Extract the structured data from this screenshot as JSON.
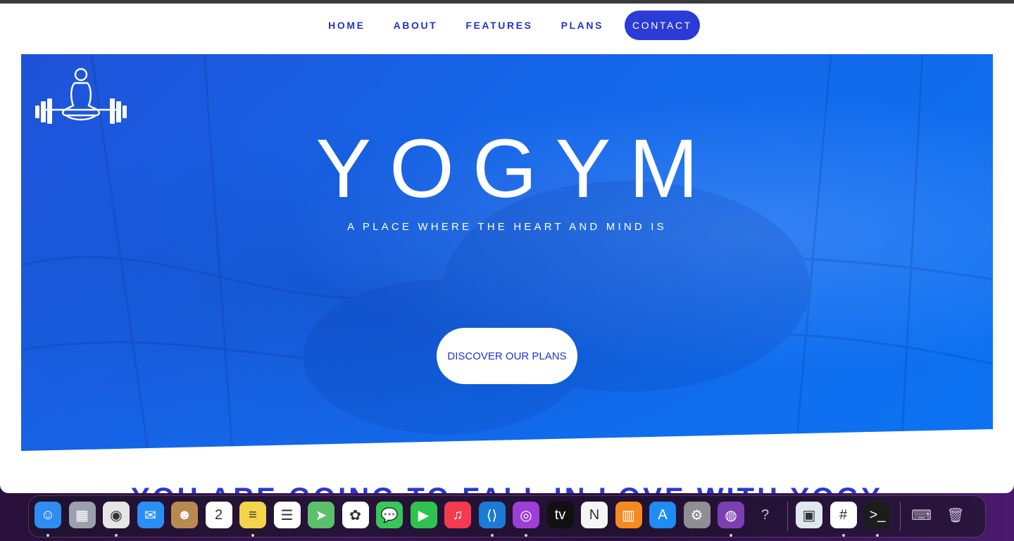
{
  "nav": {
    "items": [
      {
        "label": "HOME"
      },
      {
        "label": "ABOUT"
      },
      {
        "label": "FEATURES"
      },
      {
        "label": "PLANS"
      },
      {
        "label": "CONTACT"
      }
    ]
  },
  "hero": {
    "title": "YOGYM",
    "subtitle": "A PLACE WHERE THE HEART AND MIND IS",
    "cta_label": "DISCOVER OUR PLANS"
  },
  "section": {
    "heading": "YOU ARE GOING TO FALL IN LOVE WITH YOGYM"
  },
  "dock": {
    "apps": [
      {
        "name": "finder-icon",
        "color": "#2f8cf0",
        "glyph": "☺",
        "running": true
      },
      {
        "name": "launchpad-icon",
        "color": "#9aa0ad",
        "glyph": "▦",
        "running": false
      },
      {
        "name": "chrome-icon",
        "color": "#e5e5e5",
        "glyph": "◉",
        "running": true
      },
      {
        "name": "mail-icon",
        "color": "#2b8ef3",
        "glyph": "✉",
        "running": false
      },
      {
        "name": "contacts-icon",
        "color": "#b88a4f",
        "glyph": "☻",
        "running": false
      },
      {
        "name": "calendar-icon",
        "color": "#ffffff",
        "glyph": "2",
        "running": false
      },
      {
        "name": "notes-icon",
        "color": "#f4d44a",
        "glyph": "≡",
        "running": true
      },
      {
        "name": "reminders-icon",
        "color": "#ffffff",
        "glyph": "☰",
        "running": false
      },
      {
        "name": "maps-icon",
        "color": "#5cc06a",
        "glyph": "➤",
        "running": false
      },
      {
        "name": "photos-icon",
        "color": "#ffffff",
        "glyph": "✿",
        "running": false
      },
      {
        "name": "messages-icon",
        "color": "#39c659",
        "glyph": "💬",
        "running": false
      },
      {
        "name": "facetime-icon",
        "color": "#2fc24f",
        "glyph": "▶",
        "running": false
      },
      {
        "name": "music-icon",
        "color": "#f43a4f",
        "glyph": "♫",
        "running": false
      },
      {
        "name": "vscode-icon",
        "color": "#1b7ad4",
        "glyph": "⟨⟩",
        "running": true
      },
      {
        "name": "podcasts-icon",
        "color": "#9b3fd6",
        "glyph": "◎",
        "running": true
      },
      {
        "name": "apple-tv-icon",
        "color": "#111111",
        "glyph": "tv",
        "running": false
      },
      {
        "name": "news-icon",
        "color": "#f5f5f5",
        "glyph": "N",
        "running": false
      },
      {
        "name": "books-icon",
        "color": "#f58a1f",
        "glyph": "▥",
        "running": false
      },
      {
        "name": "app-store-icon",
        "color": "#1e8cf2",
        "glyph": "A",
        "running": false
      },
      {
        "name": "system-preferences-icon",
        "color": "#8e8e93",
        "glyph": "⚙",
        "running": false
      },
      {
        "name": "github-desktop-icon",
        "color": "#7b3fb2",
        "glyph": "◍",
        "running": true
      },
      {
        "name": "help-icon",
        "color": "transparent",
        "glyph": "?",
        "running": false
      },
      {
        "name": "preview-icon",
        "color": "#dfe7ef",
        "glyph": "▣",
        "running": false
      },
      {
        "name": "slack-icon",
        "color": "#ffffff",
        "glyph": "#",
        "running": true
      },
      {
        "name": "terminal-icon",
        "color": "#1c1c1c",
        "glyph": ">_",
        "running": true
      },
      {
        "name": "keyboard-viewer-icon",
        "color": "transparent",
        "glyph": "⌨",
        "running": false
      },
      {
        "name": "trash-icon",
        "color": "transparent",
        "glyph": "🗑",
        "running": false
      }
    ]
  }
}
